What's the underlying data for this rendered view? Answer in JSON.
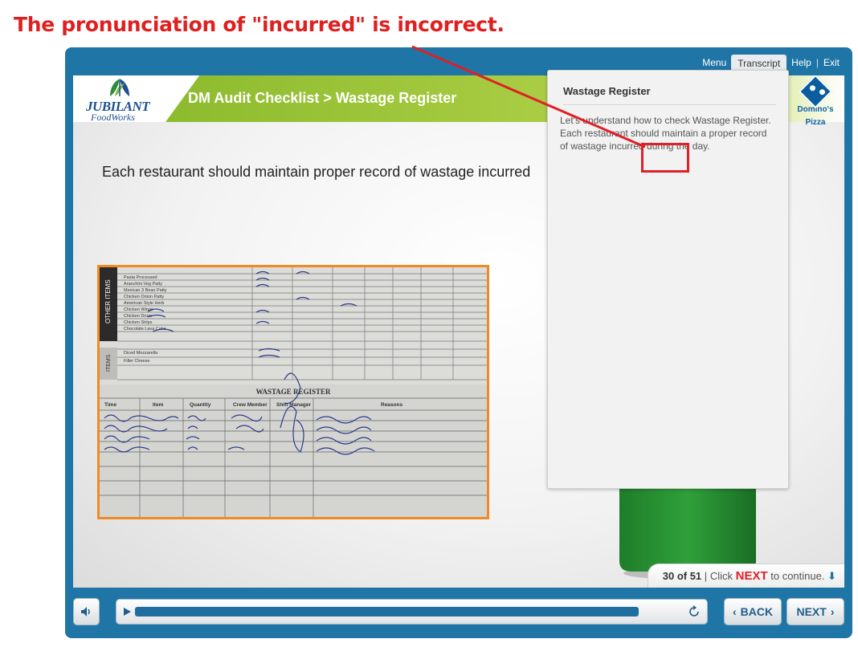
{
  "annotation": {
    "text": "The pronunciation of \"incurred\" is incorrect."
  },
  "topnav": {
    "menu": "Menu",
    "transcript": "Transcript",
    "help": "Help",
    "exit": "Exit",
    "separator": "|"
  },
  "header": {
    "logo_line1": "JUBILANT",
    "logo_line2": "FoodWorks",
    "course_title": "DM Audit Checklist > Wastage Register",
    "partner_brand_line1": "Domino's",
    "partner_brand_line2": "Pizza"
  },
  "slide": {
    "text": "Each restaurant should maintain proper record of wastage incurred"
  },
  "transcript_panel": {
    "title": "Wastage Register",
    "body_line1": "Let's understand how to check Wastage Register.",
    "body_line2": "Each restaurant should maintain a proper record of wastage incurred during the day."
  },
  "photo": {
    "side_label_top": "OTHER ITEMS",
    "side_label_bottom": "ITEMS",
    "register_title": "WASTAGE REGISTER",
    "columns": [
      "Time",
      "Item",
      "Quantity",
      "Crew Member",
      "Shift Manager",
      "Reasons"
    ],
    "top_items": [
      "Pasta Processed",
      "Aranchini Veg Patty",
      "Mexican 3 Bean Patty",
      "Chicken Onion Patty",
      "American Style Herb",
      "Chicken Wings",
      "Chicken Drum",
      "Chicken Strips",
      "Chocolate Lava Cake"
    ],
    "cheese_items": [
      "Diced Mozzarella",
      "Filler Cheese"
    ]
  },
  "footer": {
    "page": "30 of 51",
    "separator": "|",
    "click": "Click",
    "next_word": "NEXT",
    "to_continue": "to continue."
  },
  "controls": {
    "back_label": "BACK",
    "next_label": "NEXT",
    "progress_fraction": 0.92
  },
  "colors": {
    "player_blue": "#1f76a6",
    "banner_green": "#8dbb2e",
    "annotation_red": "#e02020",
    "photo_border": "#f08a24"
  }
}
